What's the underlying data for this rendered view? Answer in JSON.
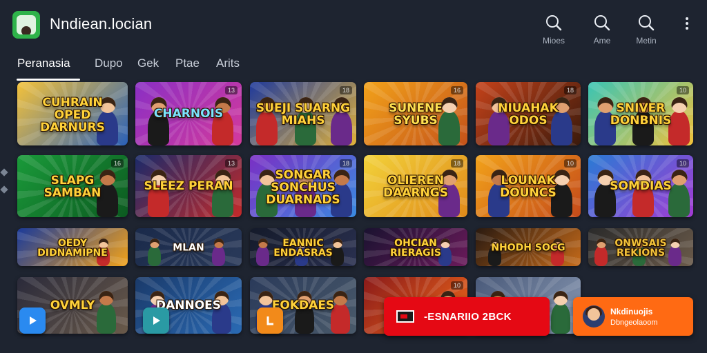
{
  "app": {
    "title": "Nndiean.locian"
  },
  "top_actions": [
    {
      "label": "Mioes",
      "icon": "search-icon"
    },
    {
      "label": "Ame",
      "icon": "search-icon"
    },
    {
      "label": "Metin",
      "icon": "search-icon"
    }
  ],
  "tabs": [
    {
      "label": "Peranasia",
      "active": true
    },
    {
      "label": "Dupo",
      "active": false
    },
    {
      "label": "Gek",
      "active": false
    },
    {
      "label": "Ptae",
      "active": false
    },
    {
      "label": "Arits",
      "active": false
    }
  ],
  "cards": [
    {
      "title": "CUHRAIN OPED DARNURS",
      "badge": "",
      "bg": [
        "#f4c23a",
        "#2a60b8"
      ],
      "title_color": "#ffd23a"
    },
    {
      "title": "CHARNOIS",
      "badge": "13",
      "bg": [
        "#8a2fc4",
        "#d43a9c"
      ],
      "title_color": "#7be3ff"
    },
    {
      "title": "SUEJI SUARNG MIAHS",
      "badge": "18",
      "bg": [
        "#1f3a9c",
        "#e0b23a"
      ],
      "title_color": "#ffd23a"
    },
    {
      "title": "SUNENE SYUBS",
      "badge": "16",
      "bg": [
        "#f2a21a",
        "#c4521a"
      ],
      "title_color": "#ffe050"
    },
    {
      "title": "NIUAHAK ODOS",
      "badge": "18",
      "bg": [
        "#c4421a",
        "#3a1a0c"
      ],
      "title_color": "#ffd23a"
    },
    {
      "title": "SNIVER DONBNIS",
      "badge": "10",
      "bg": [
        "#3ac4b4",
        "#f2c23a"
      ],
      "title_color": "#ffd23a"
    },
    {
      "title": "SLAPG SAMBAN",
      "badge": "16",
      "bg": [
        "#1a9a3a",
        "#0c5a20"
      ],
      "title_color": "#ffd23a"
    },
    {
      "title": "SLEEZ PERAN",
      "badge": "13",
      "bg": [
        "#1a2a6a",
        "#c42a2a"
      ],
      "title_color": "#ffd23a"
    },
    {
      "title": "SONGAR SONCHUS DUARNADS",
      "badge": "18",
      "bg": [
        "#7a2fc4",
        "#3a8ae0"
      ],
      "title_color": "#ffd23a"
    },
    {
      "title": "OLIEREN DAARNGS",
      "badge": "18",
      "bg": [
        "#f2d23a",
        "#e08a1a"
      ],
      "title_color": "#ffd23a"
    },
    {
      "title": "LOUNAK DOUNCS",
      "badge": "10",
      "bg": [
        "#f2a21a",
        "#c44a1a"
      ],
      "title_color": "#ffd23a"
    },
    {
      "title": "SOMDIAS",
      "badge": "10",
      "bg": [
        "#2a7ad4",
        "#a43ad4"
      ],
      "title_color": "#ffd23a"
    },
    {
      "title": "OEDY DIDNAMIPNE",
      "badge": "",
      "bg": [
        "#1a3a9a",
        "#f2a21a"
      ],
      "title_color": "#ffd23a"
    },
    {
      "title": "MLAN",
      "badge": "",
      "bg": [
        "#1a2a4a",
        "#2a3a5a"
      ],
      "title_color": "#ffffff"
    },
    {
      "title": "EANNIC ENDASRAS",
      "badge": "",
      "bg": [
        "#141a2a",
        "#2a3050"
      ],
      "title_color": "#ffd23a"
    },
    {
      "title": "OHCIAN RIERAGIS",
      "badge": "",
      "bg": [
        "#1a1230",
        "#6a1a5a"
      ],
      "title_color": "#ffd23a"
    },
    {
      "title": "NHODH SOCG",
      "badge": "",
      "bg": [
        "#2a1a10",
        "#c46a1a"
      ],
      "title_color": "#ffd23a"
    },
    {
      "title": "ONWSAIS REKIONS",
      "badge": "",
      "bg": [
        "#2a2a2a",
        "#6a5a4a"
      ],
      "title_color": "#f2c23a"
    },
    {
      "title": "OVMLY",
      "badge": "",
      "bg": [
        "#2a2a3a",
        "#6a5a4a"
      ],
      "title_color": "#ffd23a"
    },
    {
      "title": "DANNOES",
      "badge": "",
      "bg": [
        "#1a3a6a",
        "#2a6ab4"
      ],
      "title_color": "#ffffff"
    },
    {
      "title": "EOKDAES",
      "badge": "",
      "bg": [
        "#2a3a5a",
        "#4a5a6a"
      ],
      "title_color": "#ffd23a"
    },
    {
      "title": "",
      "badge": "10",
      "bg": [
        "#8a1a1a",
        "#f26a1a"
      ],
      "title_color": "#ffd23a"
    },
    {
      "title": "",
      "badge": "",
      "bg": [
        "#4a5a7a",
        "#8a9ab4"
      ],
      "title_color": "#ffd23a"
    }
  ],
  "play_badges": [
    {
      "icon": "play-icon",
      "color": "#2a8af0"
    },
    {
      "icon": "play-icon",
      "color": "#2a9aa4"
    },
    {
      "icon": "app-icon",
      "color": "#f28a1a"
    }
  ],
  "banner_red": {
    "text": "-ESNARIIO 2BCK",
    "icon": "flag-icon",
    "color": "#e50914"
  },
  "banner_orange": {
    "line1": "Nkdinuojis",
    "line2": "Dbngeolaoom",
    "color": "#ff6a13"
  }
}
